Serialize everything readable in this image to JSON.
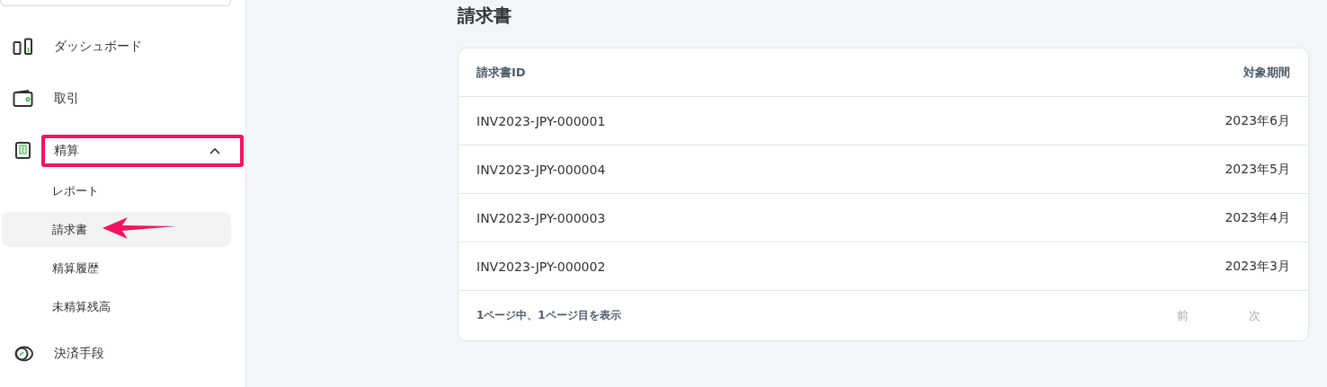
{
  "sidebar": {
    "items": [
      {
        "kind": "link",
        "label": "ダッシュボード"
      },
      {
        "kind": "link",
        "label": "取引"
      },
      {
        "kind": "group",
        "label": "精算",
        "expanded": true,
        "highlighted": true,
        "children": [
          {
            "label": "レポート",
            "selected": false,
            "pointed": false
          },
          {
            "label": "請求書",
            "selected": true,
            "pointed": true
          },
          {
            "label": "精算履歴",
            "selected": false,
            "pointed": false
          },
          {
            "label": "未精算残高",
            "selected": false,
            "pointed": false
          }
        ]
      },
      {
        "kind": "link",
        "label": "決済手段"
      }
    ]
  },
  "page": {
    "title": "請求書"
  },
  "table": {
    "columns": [
      "請求書ID",
      "対象期間"
    ],
    "rows": [
      [
        "INV2023-JPY-000001",
        "2023年6月"
      ],
      [
        "INV2023-JPY-000004",
        "2023年5月"
      ],
      [
        "INV2023-JPY-000003",
        "2023年4月"
      ],
      [
        "INV2023-JPY-000002",
        "2023年3月"
      ]
    ]
  },
  "pagination": {
    "summary": "1ページ中、1ページ目を表示",
    "buttons": [
      {
        "label": "前",
        "disabled": true
      },
      {
        "label": "次",
        "disabled": true
      }
    ]
  }
}
